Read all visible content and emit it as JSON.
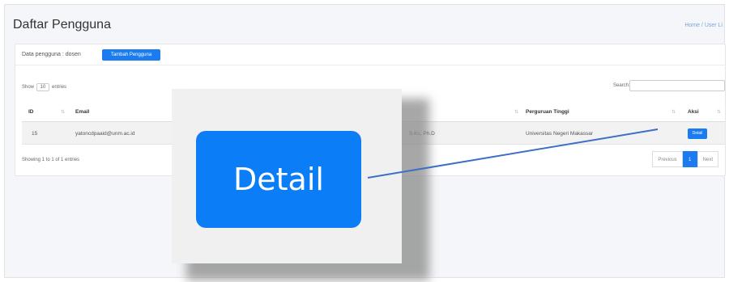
{
  "page": {
    "title": "Daftar Pengguna",
    "breadcrumb": "Home / User Li"
  },
  "card": {
    "data_label": "Data pengguna : dosen",
    "add_button": "Tambah Pengguna",
    "show_prefix": "Show",
    "show_value": "10",
    "show_suffix": "entries",
    "search_label": "Search:",
    "search_value": ""
  },
  "table": {
    "headers": [
      "ID",
      "Email",
      "Perguruan Tinggi",
      "Aksi"
    ],
    "rows": [
      {
        "id": "15",
        "email": "yatoncdpaaid@unm.ac.id",
        "name_tail": "S.Kc, Ph.D",
        "university": "Universitas Negeri Makassar",
        "action": "Detail"
      }
    ]
  },
  "footer": {
    "showing": "Showing 1 to 1 of 1 entries",
    "prev": "Previous",
    "page": "1",
    "next": "Next"
  },
  "zoom": {
    "button_label": "Detail"
  },
  "colors": {
    "primary": "#1a7cf0",
    "pointer_line": "#3d6fc4"
  }
}
